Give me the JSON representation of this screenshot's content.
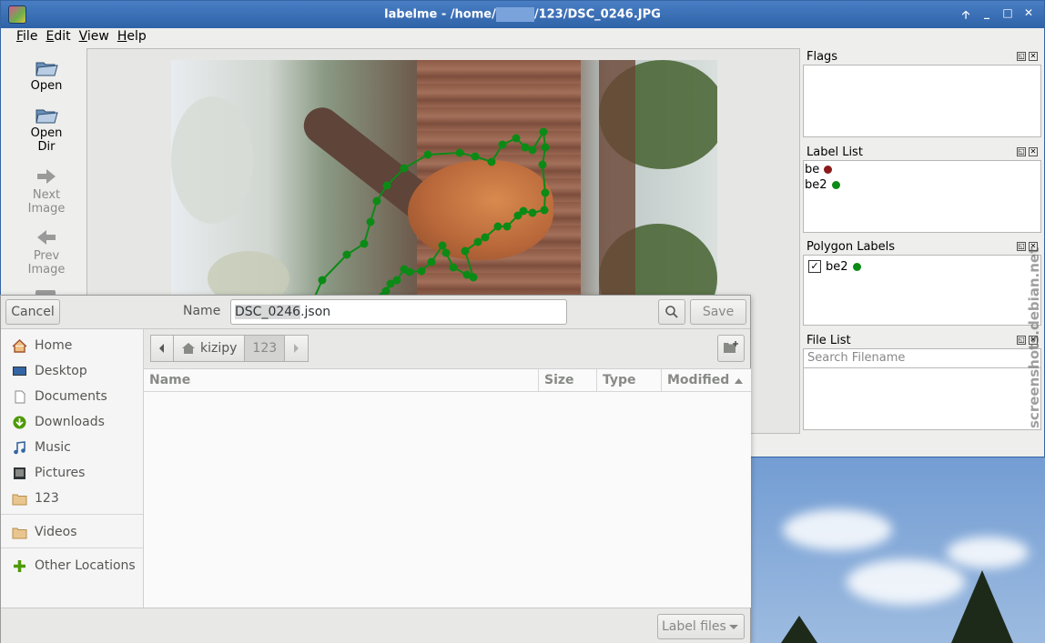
{
  "window": {
    "title_prefix": "labelme - /home/",
    "title_suffix": "/123/DSC_0246.JPG",
    "buttons": [
      "🡡",
      "_",
      "□",
      "✕"
    ]
  },
  "menu": [
    "File",
    "Edit",
    "View",
    "Help"
  ],
  "toolbar": {
    "open": "Open",
    "open_dir_1": "Open",
    "open_dir_2": "Dir",
    "next_1": "Next",
    "next_2": "Image",
    "prev_1": "Prev",
    "prev_2": "Image"
  },
  "docks": {
    "flags_title": "Flags",
    "label_list_title": "Label List",
    "labels": [
      {
        "name": "be",
        "color": "#8b1a1a"
      },
      {
        "name": "be2",
        "color": "#0c8a16"
      }
    ],
    "polygon_labels_title": "Polygon Labels",
    "polygons": [
      {
        "name": "be2",
        "checked": "✓",
        "color": "#0c8a16"
      }
    ],
    "file_list_title": "File List",
    "search_placeholder": "Search Filename"
  },
  "watermark": "screenshots.debian.net",
  "dialog": {
    "cancel": "Cancel",
    "name_label": "Name",
    "filename_sel": "DSC_0246",
    "filename_ext": ".json",
    "save": "Save",
    "places": [
      {
        "label": "Home",
        "icon": "home-icon"
      },
      {
        "label": "Desktop",
        "icon": "desktop-icon"
      },
      {
        "label": "Documents",
        "icon": "documents-icon"
      },
      {
        "label": "Downloads",
        "icon": "downloads-icon"
      },
      {
        "label": "Music",
        "icon": "music-icon"
      },
      {
        "label": "Pictures",
        "icon": "pictures-icon"
      },
      {
        "label": "123",
        "icon": "folder-icon"
      },
      {
        "label": "Videos",
        "icon": "folder-icon"
      },
      {
        "label": "Other Locations",
        "icon": "plus-icon"
      }
    ],
    "path": [
      "kizipy",
      "123"
    ],
    "columns": [
      "Name",
      "Size",
      "Type",
      "Modified"
    ],
    "filter": "Label files"
  }
}
